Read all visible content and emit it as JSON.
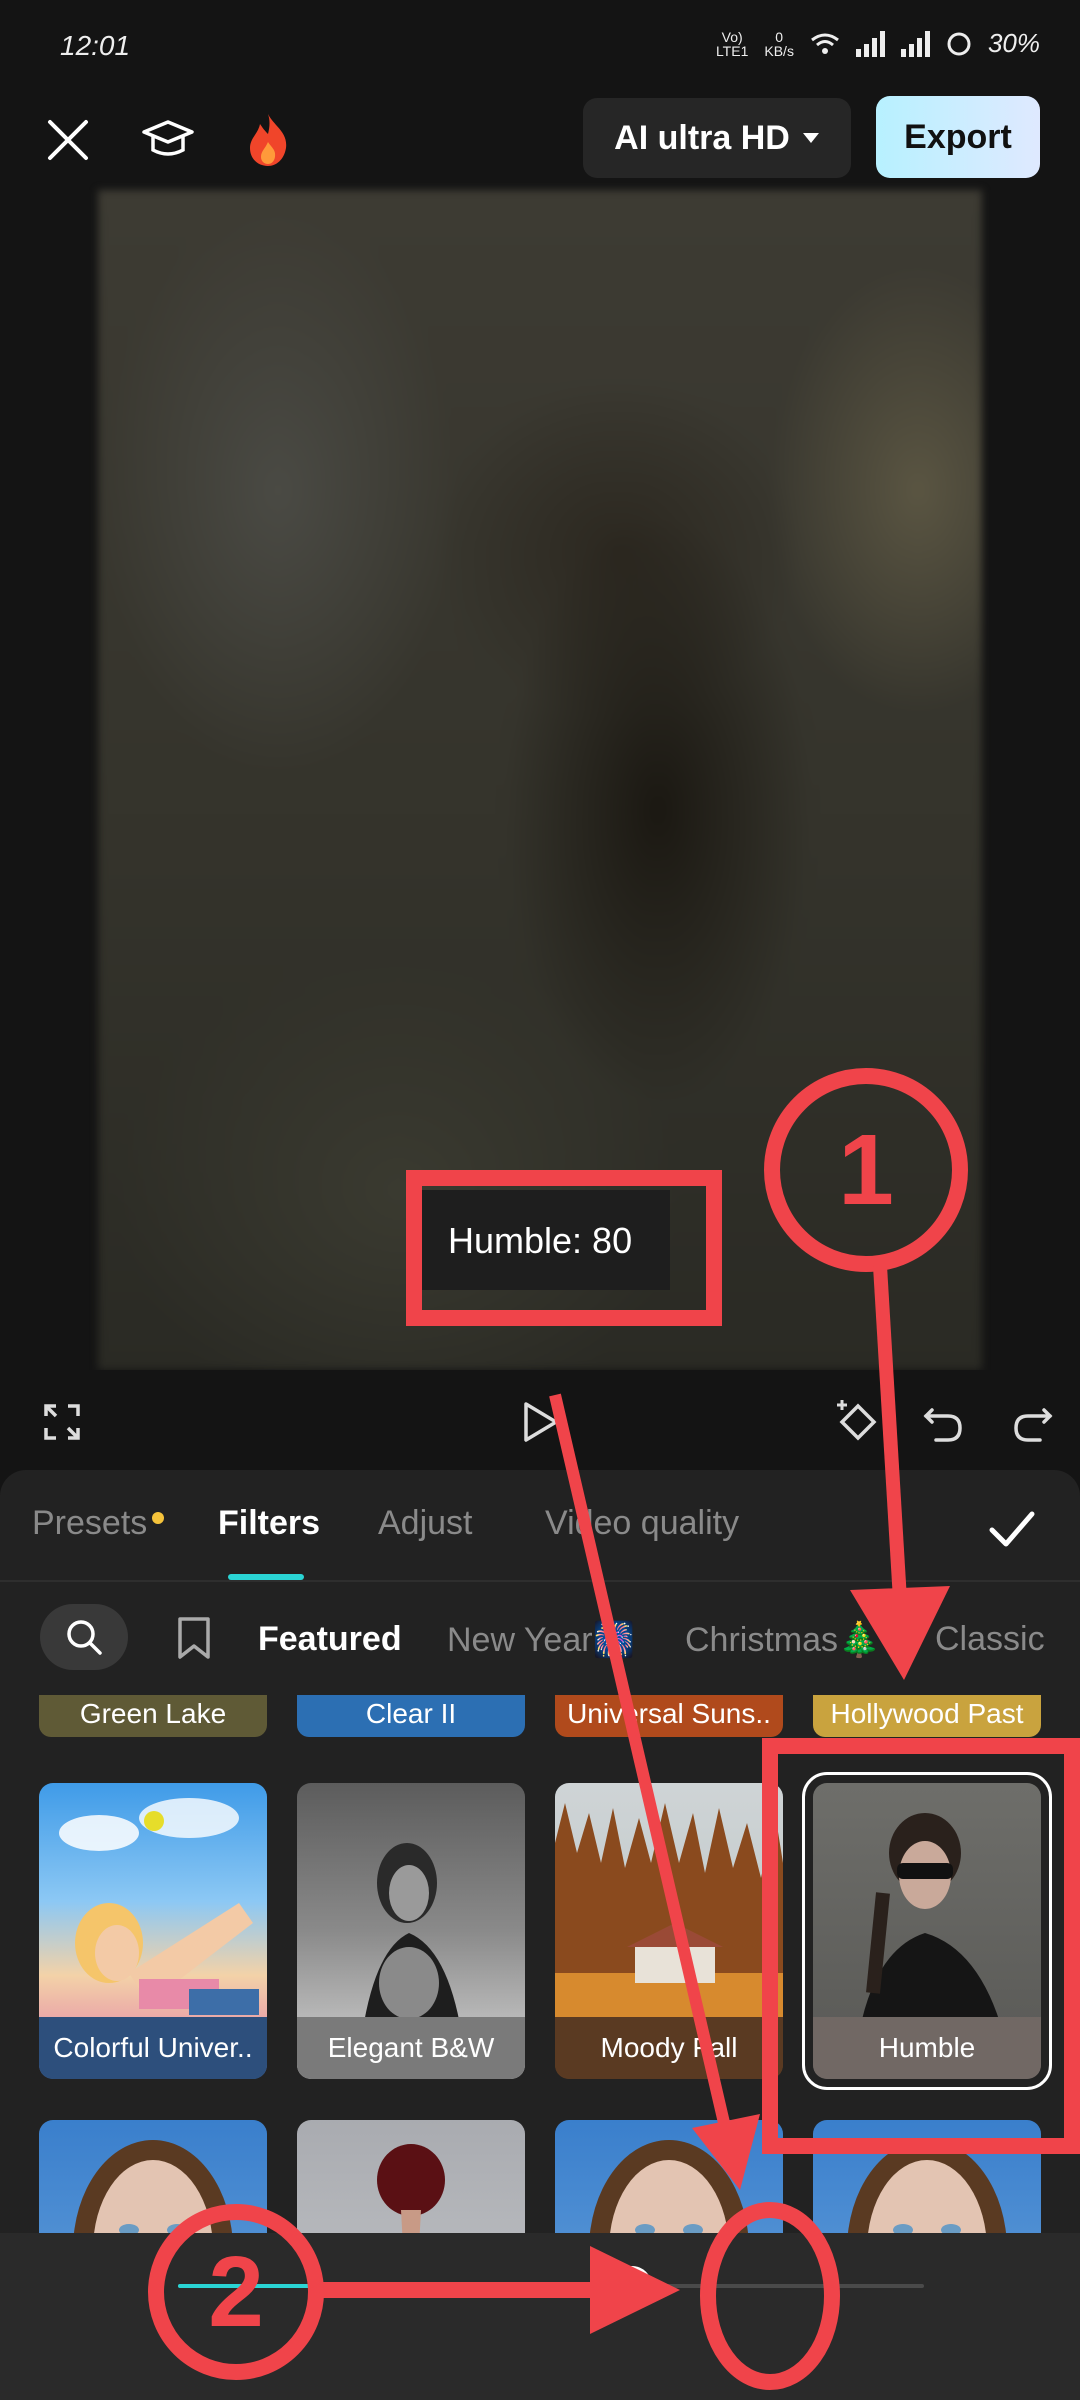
{
  "status_bar": {
    "time": "12:01",
    "network_label": "Vo)\nLTE1",
    "speed_value": "0",
    "speed_unit": "KB/s",
    "battery": "30%"
  },
  "toolbar": {
    "close_icon": "close-icon",
    "tutorial_icon": "graduation-cap-icon",
    "hot_icon": "flame-icon",
    "quality_label": "AI ultra HD",
    "export_label": "Export",
    "export_color_from": "#b7f1ff",
    "export_color_to": "#dfe9ff"
  },
  "preview": {
    "filter_label": "Humble: 80"
  },
  "tabs": [
    {
      "label": "Presets",
      "has_dot": true
    },
    {
      "label": "Filters",
      "active": true
    },
    {
      "label": "Adjust"
    },
    {
      "label": "Video quality"
    }
  ],
  "categories": [
    {
      "label": "Featured",
      "active": true
    },
    {
      "label": "New Year🎆"
    },
    {
      "label": "Christmas🎄"
    },
    {
      "label": "Classic"
    }
  ],
  "filters_row0": [
    {
      "label": "Green Lake",
      "color": "#5f5a36"
    },
    {
      "label": "Clear II",
      "color": "#2c6fb3"
    },
    {
      "label": "Universal Suns..",
      "color": "#b04a1c"
    },
    {
      "label": "Hollywood Past",
      "color": "#c9a33e"
    }
  ],
  "filters_row1": [
    {
      "label": "Colorful Univer.."
    },
    {
      "label": "Elegant B&W"
    },
    {
      "label": "Moody Fall"
    },
    {
      "label": "Humble",
      "selected": true
    }
  ],
  "slider": {
    "value": 80
  },
  "annotations": {
    "step1": "1",
    "step2": "2",
    "color": "#f0444a"
  },
  "accent_color": "#2ad4d4"
}
